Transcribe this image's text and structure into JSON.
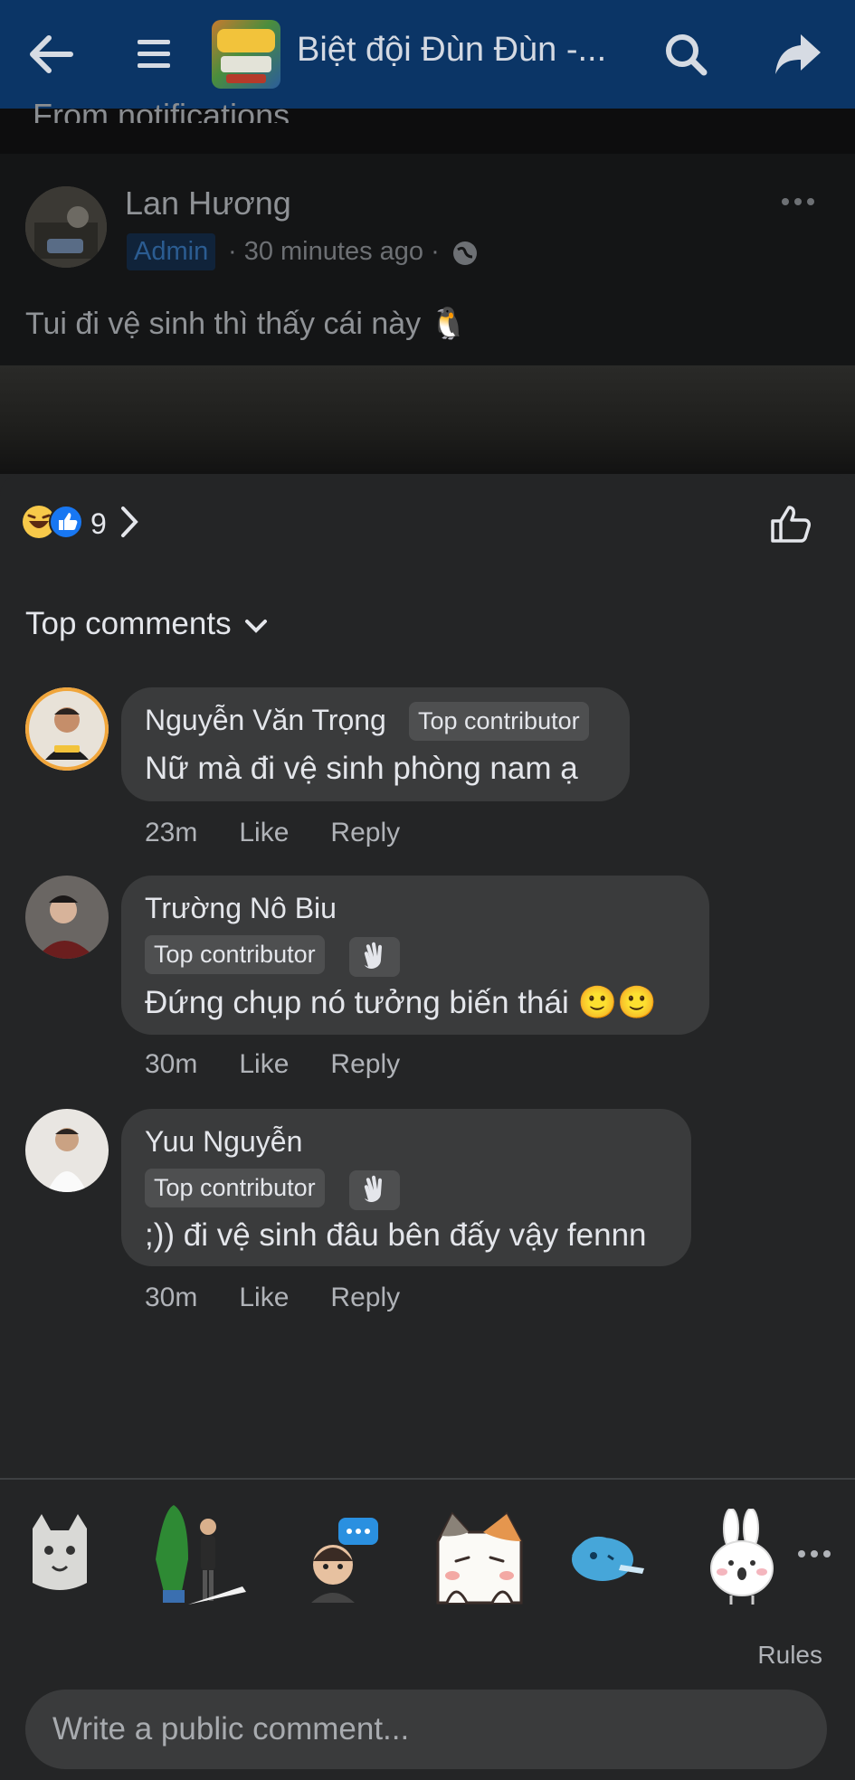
{
  "topbar": {
    "title": "Biệt đội Đùn Đùn -...",
    "back_icon": "arrow-left-icon",
    "menu_icon": "hamburger-icon",
    "search_icon": "search-icon",
    "share_icon": "share-icon"
  },
  "post": {
    "from_notifications": "From notifications",
    "author": "Lan Hương",
    "role_badge": "Admin",
    "time": "· 30 minutes ago ·",
    "text": "Tui đi vệ sinh thì thấy cái này 🐧"
  },
  "reactions": {
    "count": "9"
  },
  "comments_header": {
    "label": "Top comments"
  },
  "comments": [
    {
      "name": "Nguyễn Văn Trọng",
      "badge": "Top contributor",
      "text": "Nữ mà đi vệ sinh phòng nam ạ",
      "time": "23m",
      "like": "Like",
      "reply": "Reply"
    },
    {
      "name": "Trường Nô Biu",
      "badge": "Top contributor",
      "text": "Đứng chụp nó tưởng biến thái 🙂🙂",
      "time": "30m",
      "like": "Like",
      "reply": "Reply"
    },
    {
      "name": "Yuu Nguyễn",
      "badge": "Top contributor",
      "text": ";)) đi vệ sinh đâu bên đấy vậy fennn",
      "time": "30m",
      "like": "Like",
      "reply": "Reply"
    }
  ],
  "composer": {
    "rules": "Rules",
    "placeholder": "Write a public comment..."
  },
  "colors": {
    "topbar": "#0b3566",
    "sheet": "#242526",
    "bubble": "#3a3b3c",
    "like_blue": "#1877f2"
  }
}
